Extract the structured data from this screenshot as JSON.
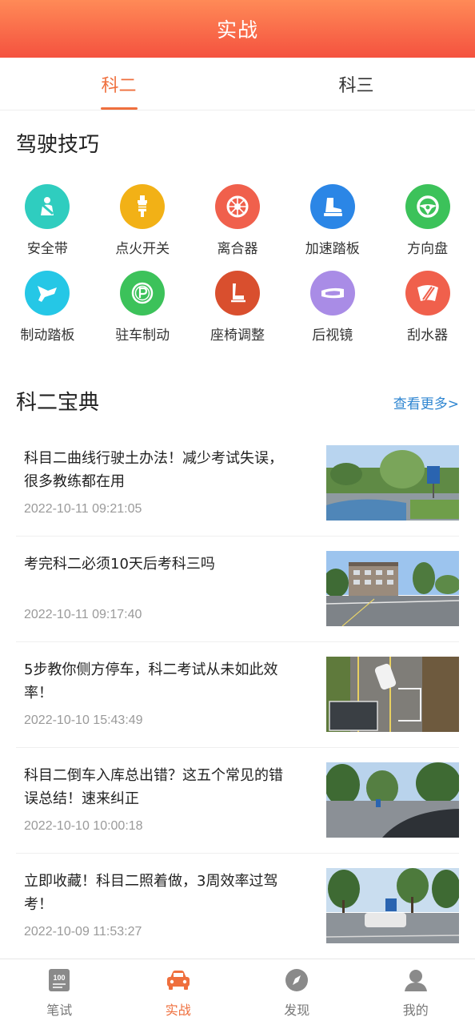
{
  "header": {
    "title": "实战"
  },
  "tabs": [
    {
      "label": "科二",
      "active": true
    },
    {
      "label": "科三",
      "active": false
    }
  ],
  "skills": {
    "title": "驾驶技巧",
    "items": [
      {
        "label": "安全带",
        "icon": "seatbelt-icon",
        "color": "#2fcdbf"
      },
      {
        "label": "点火开关",
        "icon": "spark-plug-icon",
        "color": "#f2b116"
      },
      {
        "label": "离合器",
        "icon": "clutch-icon",
        "color": "#f0604c"
      },
      {
        "label": "加速踏板",
        "icon": "accelerator-pedal-icon",
        "color": "#2b86e6"
      },
      {
        "label": "方向盘",
        "icon": "steering-wheel-icon",
        "color": "#3cc25a"
      },
      {
        "label": "制动踏板",
        "icon": "brake-pedal-icon",
        "color": "#25c7e6"
      },
      {
        "label": "驻车制动",
        "icon": "parking-brake-icon",
        "color": "#3cc25a"
      },
      {
        "label": "座椅调整",
        "icon": "seat-icon",
        "color": "#d94f2e"
      },
      {
        "label": "后视镜",
        "icon": "rearview-mirror-icon",
        "color": "#a98ce6"
      },
      {
        "label": "刮水器",
        "icon": "wiper-icon",
        "color": "#f0604c"
      }
    ]
  },
  "guide": {
    "title": "科二宝典",
    "more_label": "查看更多>",
    "articles": [
      {
        "title": "科目二曲线行驶土办法！减少考试失误，很多教练都在用",
        "time": "2022-10-11 09:21:05"
      },
      {
        "title": "考完科二必须10天后考科三吗",
        "time": "2022-10-11 09:17:40"
      },
      {
        "title": "5步教你侧方停车，科二考试从未如此效率！",
        "time": "2022-10-10 15:43:49"
      },
      {
        "title": "科目二倒车入库总出错？这五个常见的错误总结！速来纠正",
        "time": "2022-10-10 10:00:18"
      },
      {
        "title": "立即收藏！科目二照着做，3周效率过驾考！",
        "time": "2022-10-09 11:53:27"
      }
    ]
  },
  "bottom_nav": [
    {
      "label": "笔试",
      "icon": "exam-paper-icon",
      "active": false
    },
    {
      "label": "实战",
      "icon": "car-icon",
      "active": true
    },
    {
      "label": "发现",
      "icon": "compass-icon",
      "active": false
    },
    {
      "label": "我的",
      "icon": "user-icon",
      "active": false
    }
  ],
  "colors": {
    "accent": "#ef6f3d",
    "header_start": "#ff8a57",
    "header_end": "#f4523f",
    "link": "#2f86d1"
  }
}
